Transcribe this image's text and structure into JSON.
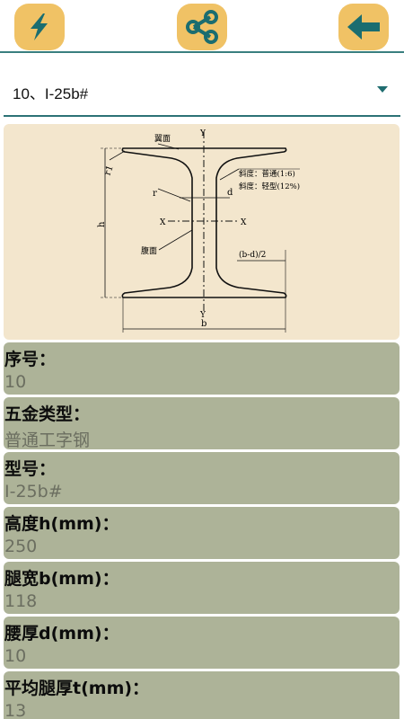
{
  "toolbar": {
    "buttons": [
      {
        "icon": "lightning-icon"
      },
      {
        "icon": "share-icon"
      },
      {
        "icon": "arrow-left-icon"
      }
    ],
    "accent_color": "#f0c265",
    "icon_color": "#1a6d70"
  },
  "selector": {
    "value": "10、I-25b#"
  },
  "diagram": {
    "labels": {
      "top_y": "Y",
      "bottom_y": "Y",
      "left_x": "X",
      "right_x": "X",
      "flange": "翼面",
      "web": "腹面",
      "slope1": "斜度：普通(1:6)",
      "slope2": "斜度：轻型(12%)",
      "r": "r",
      "r1": "r1",
      "d": "d",
      "h": "h",
      "b": "b",
      "bd2": "(b-d)/2"
    }
  },
  "fields": [
    {
      "label": "序号：",
      "value": "10"
    },
    {
      "label": "五金类型：",
      "value": "普通工字钢"
    },
    {
      "label": "型号：",
      "value": "I-25b#"
    },
    {
      "label": "高度h(mm)：",
      "value": "250"
    },
    {
      "label": "腿宽b(mm)：",
      "value": "118"
    },
    {
      "label": "腰厚d(mm)：",
      "value": "10"
    },
    {
      "label": "平均腿厚t(mm)：",
      "value": "13"
    }
  ]
}
